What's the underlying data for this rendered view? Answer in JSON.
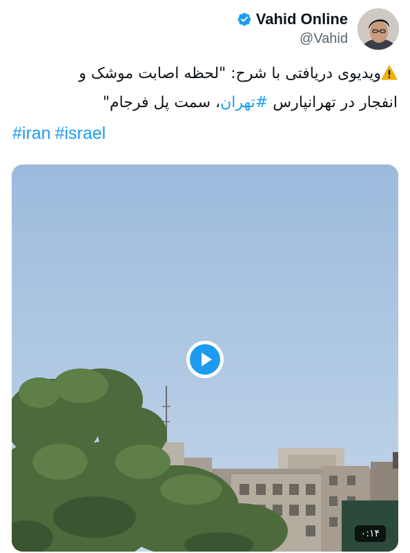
{
  "author": {
    "display_name": "Vahid Online",
    "handle": "@Vahid",
    "verified_icon": "verified-badge-icon",
    "avatar_icon": "avatar-photo"
  },
  "tweet": {
    "warning_icon": "warning-icon",
    "line1": "ویدیوی دریافتی با شرح: \"لحظه اصابت موشک و",
    "line2_pre": "انفجار در تهرانپارس ",
    "line2_tag": "#تهران",
    "line2_post": "، سمت پل فرجام\"",
    "tags": [
      "#iran",
      "#israel"
    ]
  },
  "media": {
    "play_icon": "play-icon",
    "duration": "۰:۱۴"
  },
  "colors": {
    "link": "#1d9bf0",
    "text": "#0f1419",
    "secondary": "#536471",
    "sky": "#a9c3e0"
  }
}
